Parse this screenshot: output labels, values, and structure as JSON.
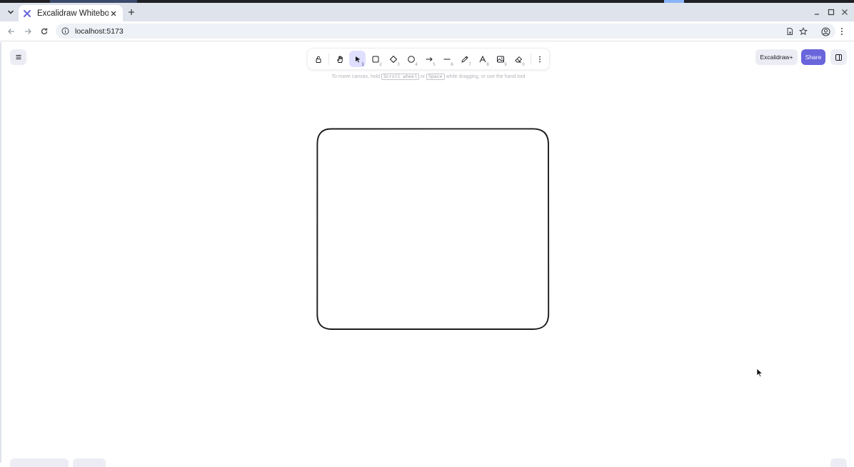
{
  "browser": {
    "tab_title": "Excalidraw Whiteboard",
    "url": "localhost:5173",
    "icons": {
      "tab_search": "chevron-down-icon",
      "favicon": "excalidraw-logo-icon",
      "tab_close": "close-icon",
      "new_tab": "plus-icon",
      "back": "arrow-left-icon",
      "forward": "arrow-right-icon",
      "reload": "reload-icon",
      "site_info": "site-info-icon",
      "install": "install-app-icon",
      "bookmark": "star-icon",
      "profile": "profile-icon",
      "menu": "kebab-menu-icon",
      "minimize": "minimize-icon",
      "maximize": "maximize-icon",
      "close_window": "close-icon"
    }
  },
  "excalidraw": {
    "tools": [
      {
        "name": "lock",
        "key": ""
      },
      {
        "name": "hand",
        "key": ""
      },
      {
        "name": "selection",
        "key": "1",
        "active": true
      },
      {
        "name": "rectangle",
        "key": "2"
      },
      {
        "name": "diamond",
        "key": "3"
      },
      {
        "name": "ellipse",
        "key": "4"
      },
      {
        "name": "arrow",
        "key": "5"
      },
      {
        "name": "line",
        "key": "6"
      },
      {
        "name": "draw",
        "key": "7"
      },
      {
        "name": "text",
        "key": "8"
      },
      {
        "name": "image",
        "key": "9"
      },
      {
        "name": "eraser",
        "key": "0"
      },
      {
        "name": "more-tools",
        "key": ""
      }
    ],
    "hint": {
      "prefix": "To move canvas, hold",
      "key1": "Scroll wheel",
      "middle": "or",
      "key2": "Space",
      "suffix": "while dragging, or use the hand tool"
    },
    "excalidraw_plus_label": "Excalidraw+",
    "share_label": "Share",
    "accent_color": "#6965db",
    "active_tool_bg": "#e0dfff"
  }
}
